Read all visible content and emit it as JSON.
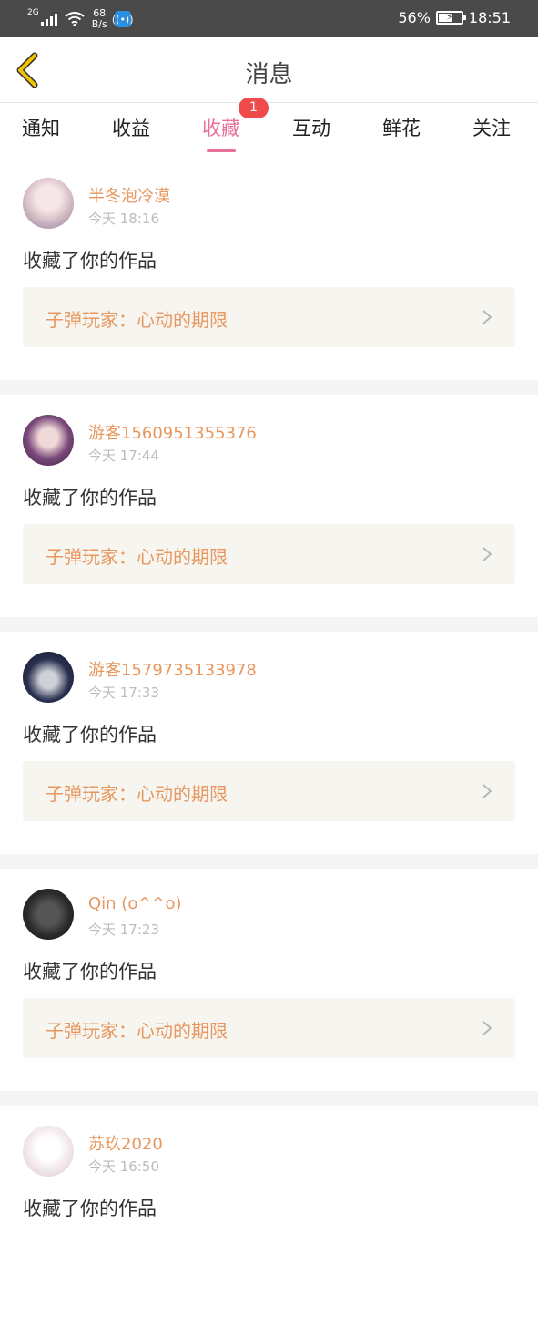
{
  "status_bar": {
    "network": "2G",
    "speed_value": "68",
    "speed_unit": "B/s",
    "app_icon": "wifi-antenna-icon",
    "battery_percent": "56%",
    "battery_level": 0.56,
    "time": "18:51",
    "bg_color": "#4a4a4a"
  },
  "header": {
    "title": "消息",
    "back_icon": "chevron-left-icon",
    "back_color": "#f2c200"
  },
  "tabs": {
    "items": [
      {
        "label": "通知"
      },
      {
        "label": "收益"
      },
      {
        "label": "收藏",
        "active": true,
        "badge": "1"
      },
      {
        "label": "互动"
      },
      {
        "label": "鲜花"
      },
      {
        "label": "关注"
      }
    ],
    "active_color": "#e8709a"
  },
  "messages": [
    {
      "username": "半冬泡冷漠",
      "time": "今天 18:16",
      "action": "收藏了你的作品",
      "work_title": "子弹玩家：心动的期限"
    },
    {
      "username": "游客1560951355376",
      "time": "今天 17:44",
      "action": "收藏了你的作品",
      "work_title": "子弹玩家：心动的期限"
    },
    {
      "username": "游客1579735133978",
      "time": "今天 17:33",
      "action": "收藏了你的作品",
      "work_title": "子弹玩家：心动的期限"
    },
    {
      "username": "Qin (o^^o)",
      "time": "今天 17:23",
      "action": "收藏了你的作品",
      "work_title": "子弹玩家：心动的期限"
    },
    {
      "username": "苏玖2020",
      "time": "今天 16:50",
      "action": "收藏了你的作品",
      "work_title": ""
    }
  ],
  "colors": {
    "username": "#e8975f",
    "work_card_bg": "#f6f5ef",
    "badge_bg": "#f04a4a"
  }
}
